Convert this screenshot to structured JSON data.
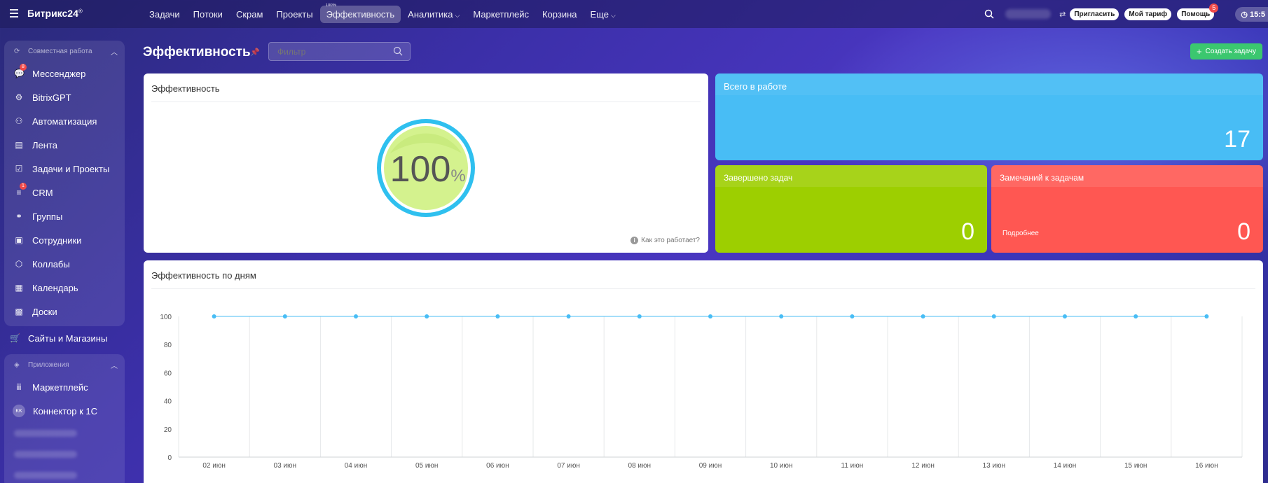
{
  "topbar": {
    "logo": "Битрикс24",
    "logo_mark": "®",
    "nav": [
      {
        "label": "Задачи"
      },
      {
        "label": "Потоки"
      },
      {
        "label": "Скрам"
      },
      {
        "label": "Проекты"
      },
      {
        "label": "Эффективность",
        "badge": "100%",
        "active": true
      },
      {
        "label": "Аналитика",
        "dropdown": true
      },
      {
        "label": "Маркетплейс"
      },
      {
        "label": "Корзина"
      },
      {
        "label": "Еще",
        "dropdown": true
      }
    ],
    "invite": "Пригласить",
    "tariff": "Мой тариф",
    "help": "Помощь",
    "help_count": "5",
    "time": "15:5"
  },
  "sidebar": {
    "group1_title": "Совместная работа",
    "items": [
      {
        "label": "Мессенджер",
        "icon": "chat-icon",
        "count": "8"
      },
      {
        "label": "BitrixGPT",
        "icon": "gpt-icon"
      },
      {
        "label": "Автоматизация",
        "icon": "robot-icon"
      },
      {
        "label": "Лента",
        "icon": "feed-icon"
      },
      {
        "label": "Задачи и Проекты",
        "icon": "tasks-icon"
      },
      {
        "label": "CRM",
        "icon": "crm-icon",
        "count": "1"
      },
      {
        "label": "Группы",
        "icon": "groups-icon"
      },
      {
        "label": "Сотрудники",
        "icon": "employees-icon"
      },
      {
        "label": "Коллабы",
        "icon": "collabs-icon"
      },
      {
        "label": "Календарь",
        "icon": "calendar-icon"
      },
      {
        "label": "Доски",
        "icon": "boards-icon"
      }
    ],
    "sites": "Сайты и Магазины",
    "group2_title": "Приложения",
    "apps": [
      {
        "label": "Маркетплейс",
        "icon": "marketplace-icon"
      },
      {
        "label": "Коннектор к 1С",
        "icon_text": "KK"
      }
    ]
  },
  "page": {
    "title": "Эффективность",
    "filter_placeholder": "Фильтр",
    "create_task": "Создать задачу"
  },
  "efficiency": {
    "title": "Эффективность",
    "value": "100",
    "unit": "%",
    "how_it_works": "Как это работает?"
  },
  "stats": {
    "in_work_label": "Всего в работе",
    "in_work_value": "17",
    "done_label": "Завершено задач",
    "done_value": "0",
    "remarks_label": "Замечаний к задачам",
    "remarks_value": "0",
    "remarks_more": "Подробнее"
  },
  "colors": {
    "in_work": "#48bdf5",
    "done": "#9dcf00",
    "remarks": "#ff5752",
    "accent_green": "#3bc76f",
    "line": "#48bdf5"
  },
  "days_card_title": "Эффективность по дням",
  "chart_data": {
    "type": "line",
    "title": "",
    "categories": [
      "02 июн",
      "03 июн",
      "04 июн",
      "05 июн",
      "06 июн",
      "07 июн",
      "08 июн",
      "09 июн",
      "10 июн",
      "11 июн",
      "12 июн",
      "13 июн",
      "14 июн",
      "15 июн",
      "16 июн"
    ],
    "series": [
      {
        "values": [
          100,
          100,
          100,
          100,
          100,
          100,
          100,
          100,
          100,
          100,
          100,
          100,
          100,
          100,
          100
        ]
      }
    ],
    "yticks": [
      "0",
      "20",
      "40",
      "60",
      "80",
      "100"
    ],
    "ylim": [
      0,
      100
    ],
    "grid": true
  }
}
